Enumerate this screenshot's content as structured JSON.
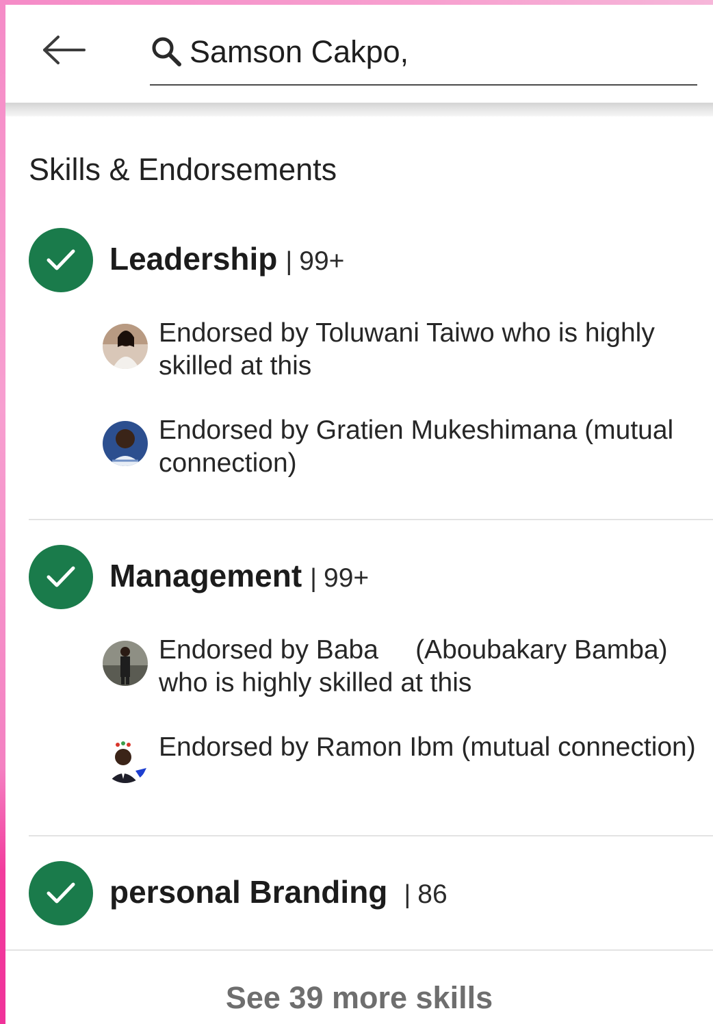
{
  "search": {
    "query": "Samson Cakpo,"
  },
  "section": {
    "title": "Skills & Endorsements"
  },
  "skills": [
    {
      "name": "Leadership",
      "separator": "|",
      "count": "99+",
      "endorsements": [
        {
          "text": "Endorsed by Toluwani Taiwo who is highly skilled at this"
        },
        {
          "text": "Endorsed by Gratien Mukeshimana (mutual connection)"
        }
      ]
    },
    {
      "name": "Management",
      "separator": "|",
      "count": "99+",
      "endorsements": [
        {
          "text": "Endorsed by Baba     (Aboubakary Bamba) who is highly skilled at this"
        },
        {
          "text": "Endorsed by Ramon Ibm (mutual connection)"
        }
      ]
    },
    {
      "name": "personal Branding",
      "separator": "|",
      "count": "86",
      "endorsements": []
    }
  ],
  "footer": {
    "see_more_label": "See 39 more skills"
  },
  "colors": {
    "accent_green": "#1a7b4b",
    "frame_pink": "#f58bc7"
  },
  "icons": {
    "back": "arrow-left-icon",
    "search": "search-icon",
    "check": "check-icon"
  }
}
